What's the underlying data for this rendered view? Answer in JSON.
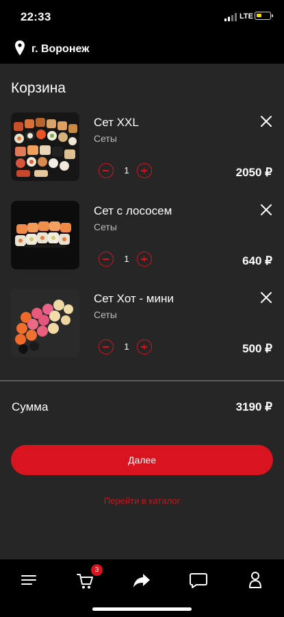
{
  "status_bar": {
    "time": "22:33",
    "network": "LTE"
  },
  "location": {
    "city": "г. Воронеж",
    "icon": "map-pin-icon"
  },
  "cart": {
    "title": "Корзина",
    "items": [
      {
        "name": "Сет XXL",
        "category": "Сеты",
        "quantity": "1",
        "price": "2050 ₽"
      },
      {
        "name": "Сет с лососем",
        "category": "Сеты",
        "quantity": "1",
        "price": "640 ₽"
      },
      {
        "name": "Сет Хот - мини",
        "category": "Сеты",
        "quantity": "1",
        "price": "500 ₽"
      }
    ],
    "sum_label": "Сумма",
    "sum_value": "3190 ₽",
    "next_button": "Далее",
    "catalog_link": "Перейти в каталог"
  },
  "bottom_nav": {
    "cart_badge": "3",
    "icons": [
      "menu-icon",
      "cart-icon",
      "share-icon",
      "chat-icon",
      "profile-icon"
    ]
  },
  "colors": {
    "accent": "#d8141f",
    "background": "#262626",
    "bar": "#000000"
  }
}
